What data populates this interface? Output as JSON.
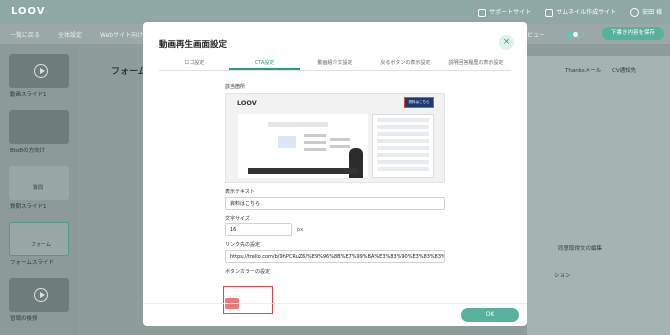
{
  "header": {
    "logo": "LOOV",
    "support_site": "サポートサイト",
    "sample_site": "サムネイル作成サイト",
    "user": "安田 様"
  },
  "menubar": {
    "list": "一覧に戻る",
    "settings": "全体設定",
    "web": "Webサイト向け",
    "preview": "ビュー",
    "save_button": "下書き内容を保存"
  },
  "sidebar": {
    "items": [
      {
        "label": "動画スライド1"
      },
      {
        "label": "BtoBの方向け"
      },
      {
        "label": "質問スライド1"
      },
      {
        "label": "フォームスライド"
      },
      {
        "label": "冒頭の挨拶"
      }
    ],
    "question_text": "質問",
    "form_text": "フォーム"
  },
  "background": {
    "title": "フォーム",
    "thanks_mail": "Thanksメール",
    "cv_notify": "CV通知先",
    "same_edit": "同意取得文の編集",
    "option": "ション"
  },
  "modal": {
    "title": "動画再生画面設定",
    "close_icon": "×",
    "tabs": [
      "ロゴ設定",
      "CTA設定",
      "動画紹介文設定",
      "戻るボタンの表示設定",
      "説明回答履歴の表示設定"
    ],
    "active_tab": 1,
    "section_label": "該当箇所",
    "preview": {
      "logo": "LOOV",
      "cta_label": "資料はこちら"
    },
    "display_text_label": "表示テキスト",
    "display_text_value": "資料はこちら",
    "font_size_label": "文字サイズ",
    "font_size_value": "16",
    "font_size_unit": "px",
    "link_label": "リンク先の設定",
    "link_value": "https://trello.com/b/9hPCRuZ6/%E9%96%8B%E7%99%BA%E3%83%90%E3%83%83%E3%82%AF%E3%83%AD%E3%82%B0",
    "button_color_label": "ボタンカラーの設定",
    "button_color": "#ee7878",
    "ok_button": "OK"
  }
}
